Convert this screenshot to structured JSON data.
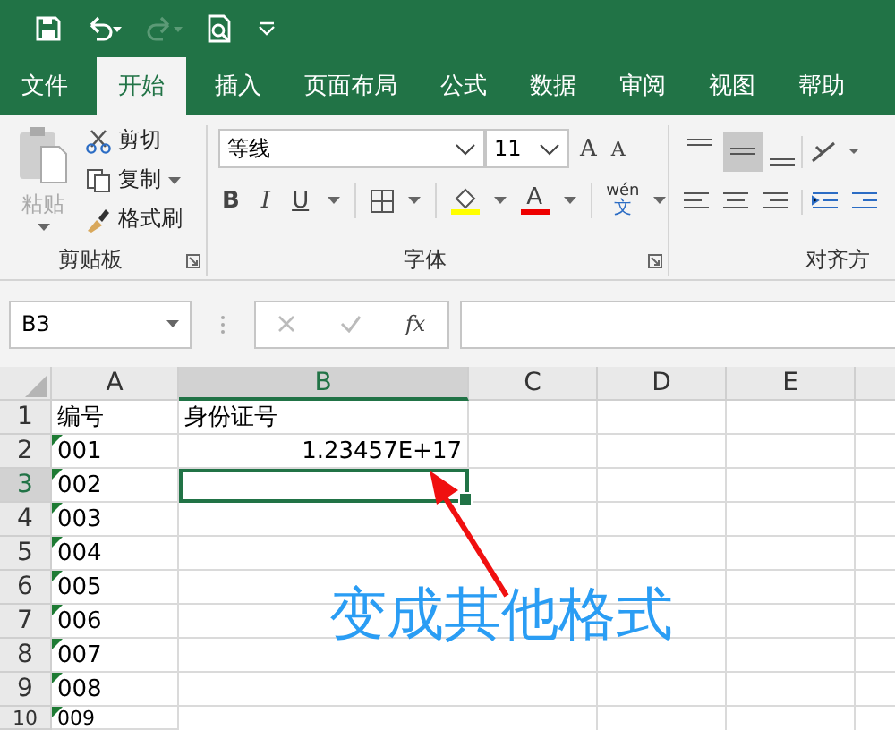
{
  "tabs": [
    {
      "label": "文件",
      "selected": false
    },
    {
      "label": "开始",
      "selected": true
    },
    {
      "label": "插入",
      "selected": false
    },
    {
      "label": "页面布局",
      "selected": false
    },
    {
      "label": "公式",
      "selected": false
    },
    {
      "label": "数据",
      "selected": false
    },
    {
      "label": "审阅",
      "selected": false
    },
    {
      "label": "视图",
      "selected": false
    },
    {
      "label": "帮助",
      "selected": false
    }
  ],
  "ribbon": {
    "clipboard": {
      "paste": {
        "label": "粘贴",
        "disabled": true
      },
      "commands": [
        "剪切",
        "复制",
        "格式刷"
      ],
      "label": "剪贴板"
    },
    "font": {
      "font_name": "等线",
      "font_size": "11",
      "grow": "A",
      "shrink": "A",
      "styles": [
        "B",
        "I",
        "U"
      ],
      "font_color": "A",
      "phonetic_top": "wén",
      "phonetic_bottom": "文",
      "label": "字体"
    },
    "alignment": {
      "label": "对齐方"
    }
  },
  "formula_bar": {
    "name_box": "B3",
    "function": "fx"
  },
  "columns": [
    {
      "label": "A",
      "selected": false
    },
    {
      "label": "B",
      "selected": true
    },
    {
      "label": "C",
      "selected": false
    },
    {
      "label": "D",
      "selected": false
    },
    {
      "label": "E",
      "selected": false
    }
  ],
  "rows": [
    {
      "header": "1",
      "selected": false,
      "cells": [
        {
          "text": "编号",
          "kind": "text",
          "flagged": false,
          "selected": false
        },
        {
          "text": "身份证号",
          "kind": "text",
          "flagged": false,
          "selected": false
        }
      ]
    },
    {
      "header": "2",
      "selected": false,
      "cells": [
        {
          "text": "001",
          "kind": "text",
          "flagged": true,
          "selected": false
        },
        {
          "text": "1.23457E+17",
          "kind": "number",
          "flagged": false,
          "selected": false
        }
      ]
    },
    {
      "header": "3",
      "selected": true,
      "cells": [
        {
          "text": "002",
          "kind": "text",
          "flagged": true,
          "selected": false
        },
        {
          "text": "",
          "kind": "text",
          "flagged": false,
          "selected": true
        }
      ]
    },
    {
      "header": "4",
      "selected": false,
      "cells": [
        {
          "text": "003",
          "kind": "text",
          "flagged": true,
          "selected": false
        }
      ]
    },
    {
      "header": "5",
      "selected": false,
      "cells": [
        {
          "text": "004",
          "kind": "text",
          "flagged": true,
          "selected": false
        }
      ]
    },
    {
      "header": "6",
      "selected": false,
      "cells": [
        {
          "text": "005",
          "kind": "text",
          "flagged": true,
          "selected": false
        }
      ]
    },
    {
      "header": "7",
      "selected": false,
      "cells": [
        {
          "text": "006",
          "kind": "text",
          "flagged": true,
          "selected": false
        }
      ]
    },
    {
      "header": "8",
      "selected": false,
      "cells": [
        {
          "text": "007",
          "kind": "text",
          "flagged": true,
          "selected": false
        }
      ]
    },
    {
      "header": "9",
      "selected": false,
      "cells": [
        {
          "text": "008",
          "kind": "text",
          "flagged": true,
          "selected": false
        }
      ]
    },
    {
      "header": "10",
      "selected": false,
      "cells": [
        {
          "text": "009",
          "kind": "text",
          "flagged": true,
          "selected": false
        }
      ]
    }
  ],
  "annotation": {
    "text": "变成其他格式"
  }
}
